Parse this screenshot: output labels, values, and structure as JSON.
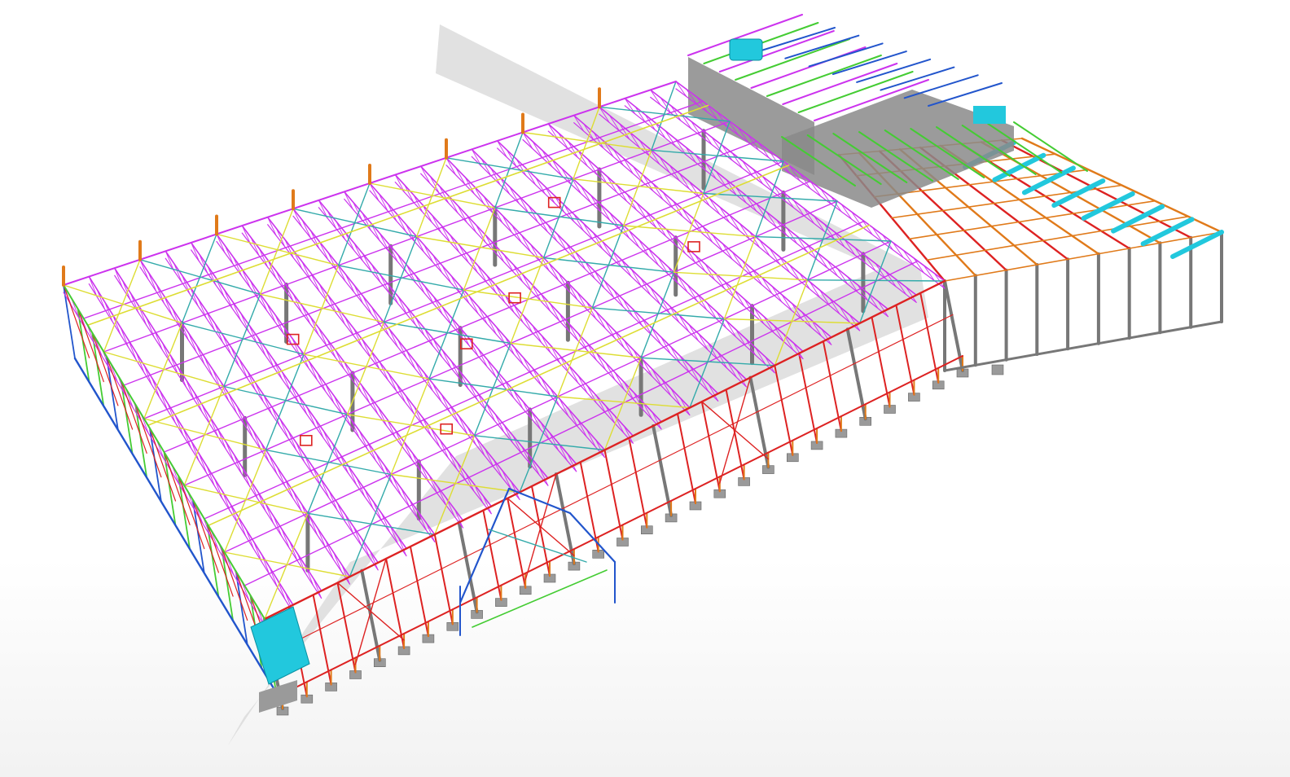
{
  "viewport": {
    "background": "#ffffff",
    "floor_color": "#f2f2f2"
  },
  "model": {
    "name": "",
    "shadow_color": "#d9d9d9",
    "member_colors": {
      "roof_truss": "#cc33ee",
      "eave_beam": "#dd2222",
      "column": "#777777",
      "footing": "#9a9a9a",
      "bracing_teal": "#33aaaa",
      "bracing_yellow": "#dddd33",
      "bracing_green": "#44cc33",
      "side_blue": "#2255cc",
      "annex_orange": "#e07a1a",
      "annex_cyan": "#22c8dd",
      "mezzanine_deck": "#8a8a8a",
      "equipment": "#22c8dd"
    }
  }
}
